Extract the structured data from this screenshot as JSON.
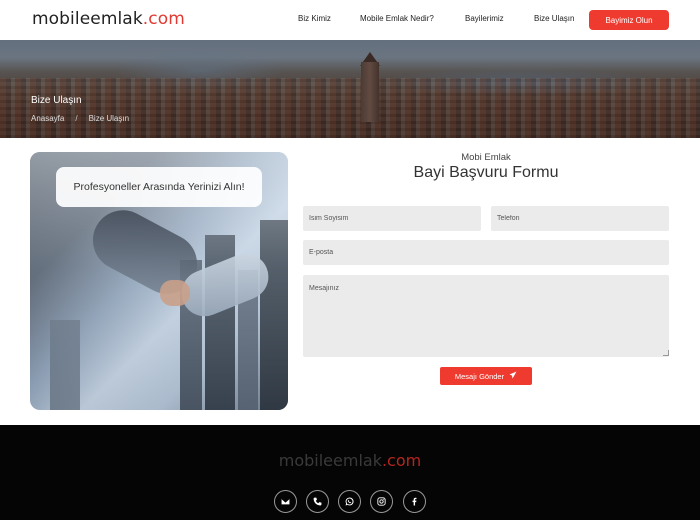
{
  "header": {
    "logo_main": "mobileemlak",
    "logo_tld": ".com",
    "nav": [
      "Biz Kimiz",
      "Mobile Emlak Nedir?",
      "Bayilerimiz",
      "Bize Ulaşın"
    ],
    "cta_label": "Bayimiz Olun"
  },
  "hero": {
    "title": "Bize Ulaşın",
    "breadcrumbs": [
      "Anasayfa",
      "/",
      "Bize Ulaşın"
    ]
  },
  "promo": {
    "badge_text": "Profesyoneller Arasında Yerinizi Alın!"
  },
  "form": {
    "kicker": "Mobi Emlak",
    "title": "Bayi Başvuru Formu",
    "name_placeholder": "İsim Soyisim",
    "phone_placeholder": "Telefon",
    "email_placeholder": "E-posta",
    "message_placeholder": "Mesajınız",
    "submit_label": "Mesajı Gönder",
    "submit_icon": "paper-plane-icon"
  },
  "footer": {
    "logo_main": "mobileemlak",
    "logo_tld": ".com",
    "social_icons": [
      "envelope-icon",
      "phone-icon",
      "whatsapp-icon",
      "instagram-icon",
      "facebook-icon"
    ]
  },
  "colors": {
    "accent": "#ef3b2f",
    "footer_bg": "#050505",
    "field_bg": "#ebebeb"
  }
}
